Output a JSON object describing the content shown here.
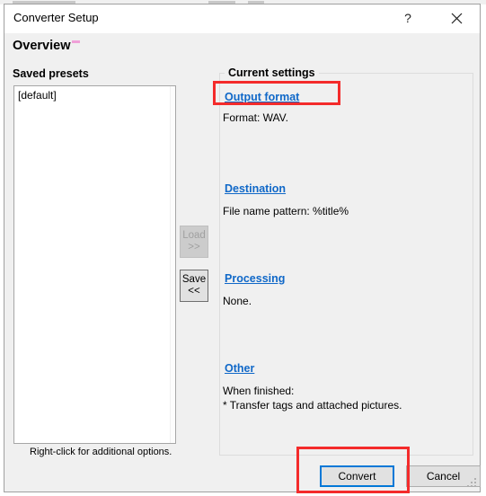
{
  "window": {
    "title": "Converter Setup",
    "help_icon": "question-mark-icon",
    "close_icon": "close-icon",
    "heading": "Overview"
  },
  "presets": {
    "label": "Saved presets",
    "items": [
      "[default]"
    ],
    "hint": "Right-click for additional options."
  },
  "transfer": {
    "load": {
      "label": "Load",
      "arrows": ">>",
      "enabled": false
    },
    "save": {
      "label": "Save",
      "arrows": "<<",
      "enabled": true
    }
  },
  "settings": {
    "group_title": "Current settings",
    "sections": [
      {
        "link": "Output format",
        "body": "Format: WAV."
      },
      {
        "link": "Destination",
        "body": "File name pattern: %title%"
      },
      {
        "link": "Processing",
        "body": "None."
      },
      {
        "link": "Other",
        "body": "When finished:\n* Transfer tags and attached pictures."
      }
    ]
  },
  "buttons": {
    "convert": "Convert",
    "cancel": "Cancel"
  },
  "colors": {
    "link": "#1068c8",
    "focus_border": "#0078d7",
    "annotation": "#f42b2b",
    "heading_dash": "#f0a0d8",
    "dialog_bg": "#f0f0f0"
  }
}
